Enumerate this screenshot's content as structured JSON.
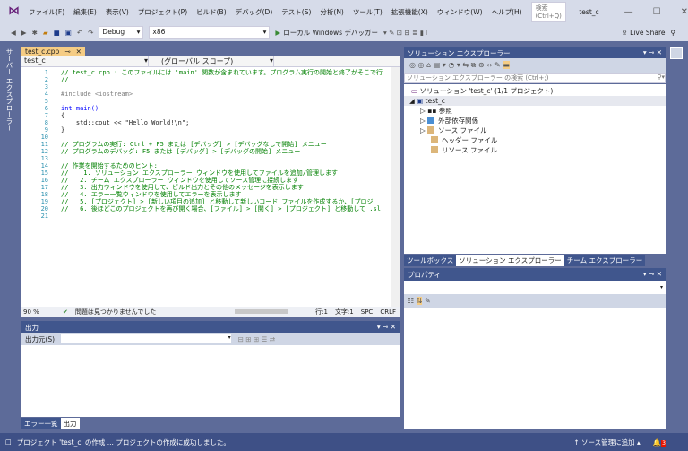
{
  "titlebar": {
    "menus": [
      "ファイル(F)",
      "編集(E)",
      "表示(V)",
      "プロジェクト(P)",
      "ビルド(B)",
      "デバッグ(D)",
      "テスト(S)",
      "分析(N)",
      "ツール(T)",
      "拡張機能(X)",
      "ウィンドウ(W)",
      "ヘルプ(H)"
    ],
    "search_placeholder": "検索 (Ctrl+Q)",
    "project": "test_c"
  },
  "toolbar": {
    "config": "Debug",
    "platform": "x86",
    "run": "ローカル Windows デバッガー",
    "live_share": "Live Share"
  },
  "left_sidebar": {
    "label": "サーバー エクスプローラー"
  },
  "editor": {
    "tab": "test_c.cpp",
    "project_combo": "test_c",
    "scope_combo": "(グローバル スコープ)",
    "lines": [
      {
        "n": "1",
        "t": "// test_c.cpp : このファイルには 'main' 関数が含まれています。プログラム実行の開始と終了がそこで行",
        "c": "cm"
      },
      {
        "n": "2",
        "t": "//",
        "c": "cm"
      },
      {
        "n": "3",
        "t": "",
        "c": ""
      },
      {
        "n": "4",
        "t": "#include <iostream>",
        "c": "pp"
      },
      {
        "n": "5",
        "t": "",
        "c": ""
      },
      {
        "n": "6",
        "t": "int main()",
        "c": "kw"
      },
      {
        "n": "7",
        "t": "{",
        "c": ""
      },
      {
        "n": "8",
        "t": "    std::cout << \"Hello World!\\n\";",
        "c": ""
      },
      {
        "n": "9",
        "t": "}",
        "c": ""
      },
      {
        "n": "10",
        "t": "",
        "c": ""
      },
      {
        "n": "11",
        "t": "// プログラムの実行: Ctrl + F5 または [デバッグ] > [デバッグなしで開始] メニュー",
        "c": "cm"
      },
      {
        "n": "12",
        "t": "// プログラムのデバッグ: F5 または [デバッグ] > [デバッグの開始] メニュー",
        "c": "cm"
      },
      {
        "n": "13",
        "t": "",
        "c": ""
      },
      {
        "n": "14",
        "t": "// 作業を開始するためのヒント:",
        "c": "cm"
      },
      {
        "n": "15",
        "t": "//    1. ソリューション エクスプローラー ウィンドウを使用してファイルを追加/管理します",
        "c": "cm"
      },
      {
        "n": "16",
        "t": "//   2. チーム エクスプローラー ウィンドウを使用してソース管理に接続します",
        "c": "cm"
      },
      {
        "n": "17",
        "t": "//   3. 出力ウィンドウを使用して、ビルド出力とその他のメッセージを表示します",
        "c": "cm"
      },
      {
        "n": "18",
        "t": "//   4. エラー一覧ウィンドウを使用してエラーを表示します",
        "c": "cm"
      },
      {
        "n": "19",
        "t": "//   5. [プロジェクト] > [新しい項目の追加] と移動して新しいコード ファイルを作成するか、[プロジ",
        "c": "cm"
      },
      {
        "n": "20",
        "t": "//   6. 後ほどこのプロジェクトを再び開く場合、[ファイル] > [開く] > [プロジェクト] と移動して .sl",
        "c": "cm"
      },
      {
        "n": "21",
        "t": "",
        "c": ""
      }
    ],
    "zoom": "90 %",
    "issues": "問題は見つかりませんでした",
    "line": "行:1",
    "col": "文字:1",
    "spc": "SPC",
    "crlf": "CRLF"
  },
  "output": {
    "title": "出力",
    "source_label": "出力元(S):",
    "tabs": [
      "エラー一覧",
      "出力"
    ]
  },
  "solution_explorer": {
    "title": "ソリューション エクスプローラー",
    "search_placeholder": "ソリューション エクスプローラー の検索 (Ctrl+;)",
    "tree": [
      "ソリューション 'test_c' (1/1 プロジェクト)",
      "test_c",
      "参照",
      "外部依存関係",
      "ソース ファイル",
      "ヘッダー ファイル",
      "リソース ファイル"
    ],
    "tabs": [
      "ツールボックス",
      "ソリューション エクスプローラー",
      "チーム エクスプローラー"
    ]
  },
  "properties": {
    "title": "プロパティ"
  },
  "statusbar": {
    "message": "プロジェクト 'test_c' の作成 ... プロジェクトの作成に成功しました。",
    "source_control": "ソース管理に追加",
    "notifications": "3"
  }
}
